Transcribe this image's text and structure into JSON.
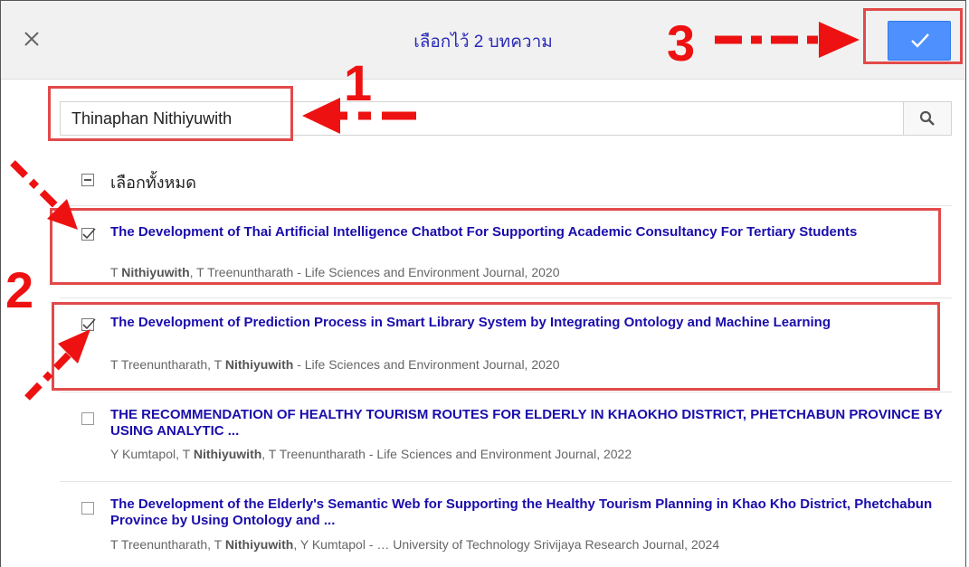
{
  "header": {
    "title": "เลือกไว้ 2 บทความ",
    "close_icon": "close-icon",
    "confirm_icon": "check-icon",
    "accent": "#4d90fe"
  },
  "search": {
    "value": "Thinaphan Nithiyuwith",
    "icon": "search-icon"
  },
  "select_all": {
    "label": "เลือกทั้งหมด"
  },
  "articles": [
    {
      "title": "The Development of Thai Artificial Intelligence Chatbot For Supporting Academic Consultancy For Tertiary Students",
      "authors_pre": "T ",
      "authors_bold": "Nithiyuwith",
      "authors_post": ", T Treenuntharath - Life Sciences and Environment Journal, 2020",
      "checked": true
    },
    {
      "title": "The Development of Prediction Process in Smart Library System by Integrating Ontology and Machine Learning",
      "authors_pre": "T Treenuntharath, T ",
      "authors_bold": "Nithiyuwith",
      "authors_post": " - Life Sciences and Environment Journal, 2020",
      "checked": true
    },
    {
      "title": "THE RECOMMENDATION OF HEALTHY TOURISM ROUTES FOR ELDERLY IN KHAOKHO DISTRICT, PHETCHABUN PROVINCE BY USING ANALYTIC ...",
      "authors_pre": "Y Kumtapol, T ",
      "authors_bold": "Nithiyuwith",
      "authors_post": ", T Treenuntharath - Life Sciences and Environment Journal, 2022",
      "checked": false
    },
    {
      "title": "The Development of the Elderly's Semantic Web for Supporting the Healthy Tourism Planning in Khao Kho District, Phetchabun Province by Using Ontology and ...",
      "authors_pre": "T Treenuntharath, T ",
      "authors_bold": "Nithiyuwith",
      "authors_post": ", Y Kumtapol - … University of Technology Srivijaya Research Journal, 2024",
      "checked": false
    }
  ],
  "annotations": {
    "step1": "1",
    "step2": "2",
    "step3": "3",
    "color": "#ee1111"
  }
}
